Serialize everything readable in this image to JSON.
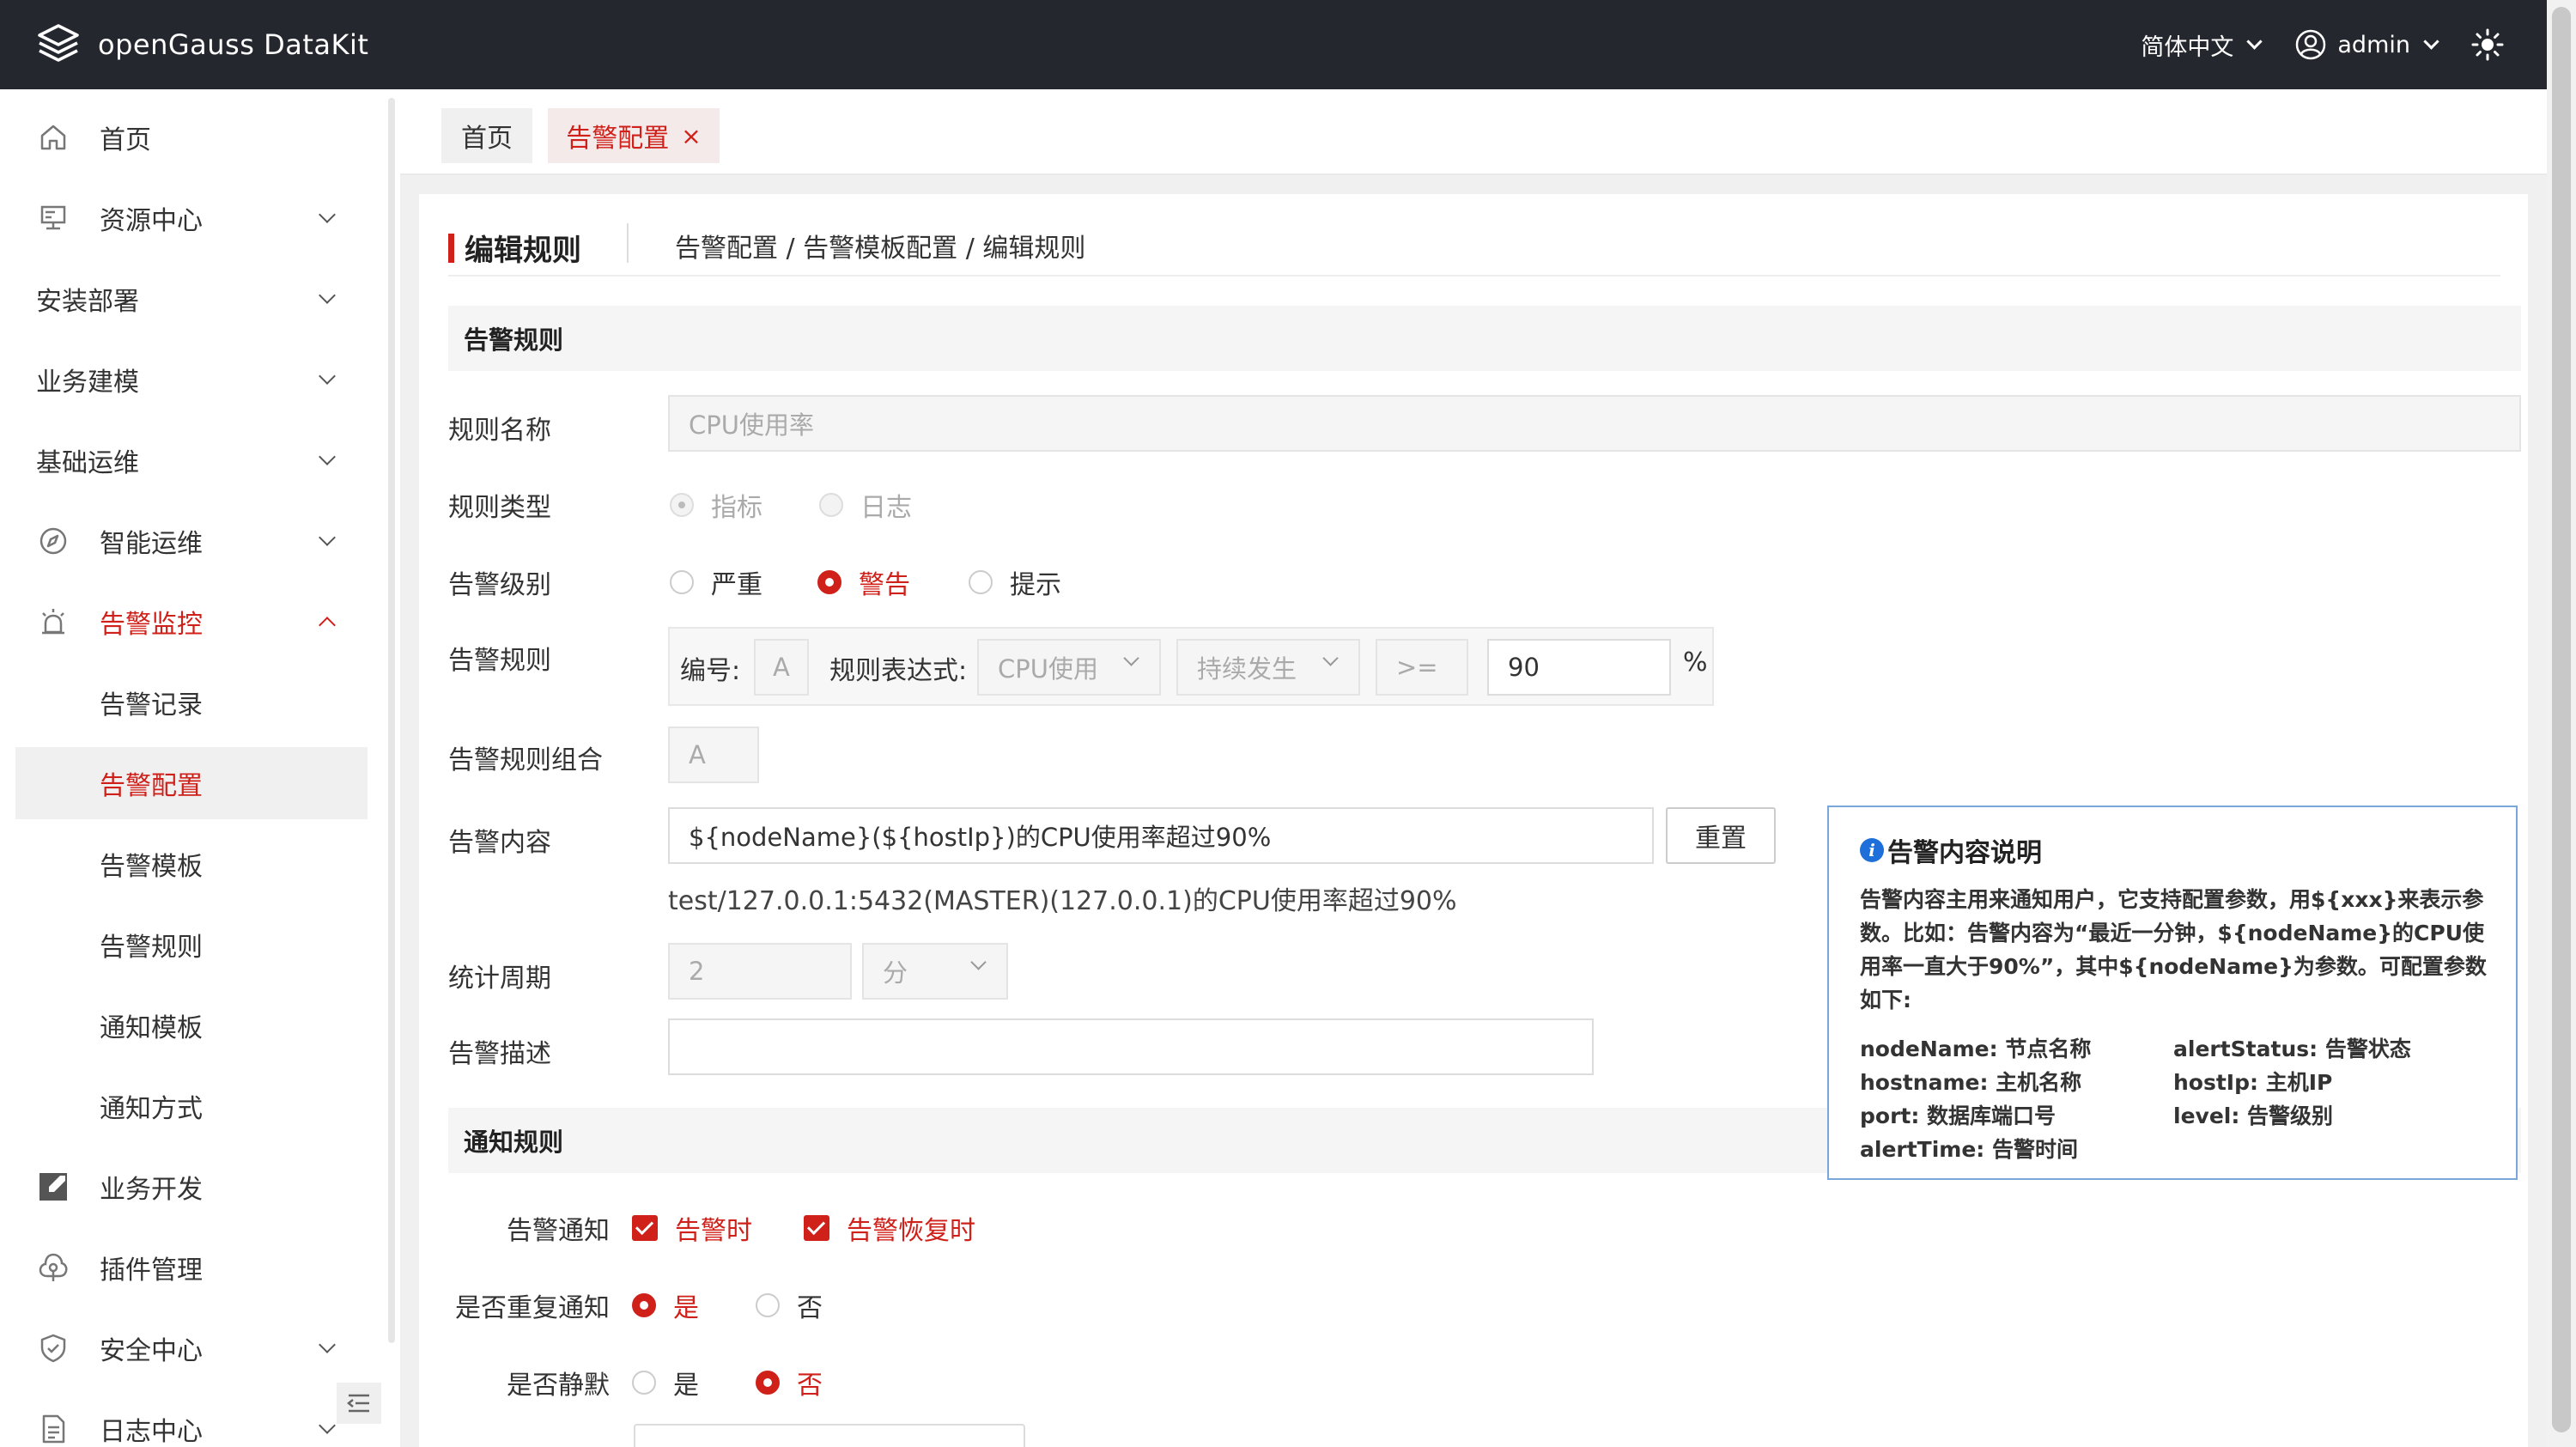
{
  "topbar": {
    "brand": "openGauss DataKit",
    "language": "简体中文",
    "user": "admin",
    "icons": [
      "layers-logo-icon",
      "user-circle-icon",
      "sun-icon"
    ]
  },
  "sidebar": {
    "items": [
      {
        "label": "首页",
        "icon": "home-icon"
      },
      {
        "label": "资源中心",
        "icon": "server-icon"
      },
      {
        "label": "安装部署"
      },
      {
        "label": "业务建模"
      },
      {
        "label": "基础运维"
      },
      {
        "label": "智能运维",
        "icon": "compass-icon"
      },
      {
        "label": "告警监控",
        "icon": "alarm-icon"
      },
      {
        "label": "告警记录"
      },
      {
        "label": "告警配置"
      },
      {
        "label": "告警模板"
      },
      {
        "label": "告警规则"
      },
      {
        "label": "通知模板"
      },
      {
        "label": "通知方式"
      },
      {
        "label": "业务开发",
        "icon": "edit-box-icon"
      },
      {
        "label": "插件管理",
        "icon": "plugin-icon"
      },
      {
        "label": "安全中心",
        "icon": "shield-icon"
      },
      {
        "label": "日志中心",
        "icon": "document-icon"
      }
    ]
  },
  "tabs": [
    {
      "label": "首页"
    },
    {
      "label": "告警配置",
      "close": "×"
    }
  ],
  "page": {
    "title": "编辑规则",
    "breadcrumb": "告警配置 / 告警模板配置 / 编辑规则"
  },
  "form": {
    "section_alert": "告警规则",
    "rule_name_label": "规则名称",
    "rule_name_placeholder": "CPU使用率",
    "rule_type_label": "规则类型",
    "rule_type_options": [
      "指标",
      "日志"
    ],
    "level_label": "告警级别",
    "level_options": [
      "严重",
      "警告",
      "提示"
    ],
    "rule_label": "告警规则",
    "rule_no_label": "编号:",
    "rule_no_value": "A",
    "rule_expr_label": "规则表达式:",
    "rule_metric": "CPU使用",
    "rule_duration": "持续发生",
    "rule_operator": ">=",
    "rule_threshold": "90",
    "rule_unit": "%",
    "combo_label": "告警规则组合",
    "combo_value": "A",
    "content_label": "告警内容",
    "content_value": "${nodeName}(${hostIp})的CPU使用率超过90%",
    "reset_button": "重置",
    "content_preview": "test/127.0.0.1:5432(MASTER)(127.0.0.1)的CPU使用率超过90%",
    "period_label": "统计周期",
    "period_value": "2",
    "period_unit": "分",
    "desc_label": "告警描述",
    "desc_value": ""
  },
  "notify": {
    "section": "通知规则",
    "notify_label": "告警通知",
    "notify_on_alert": "告警时",
    "notify_on_recover": "告警恢复时",
    "repeat_label": "是否重复通知",
    "repeat_yes": "是",
    "repeat_no": "否",
    "silent_label": "是否静默",
    "silent_yes": "是",
    "silent_no": "否"
  },
  "help": {
    "title": "告警内容说明",
    "description": "告警内容主用来通知用户，它支持配置参数，用${xxx}来表示参数。比如：告警内容为“最近一分钟，${nodeName}的CPU使用率一直大于90%”，其中${nodeName}为参数。可配置参数如下:",
    "params": [
      "nodeName: 节点名称",
      "alertStatus: 告警状态",
      "hostname: 主机名称",
      "hostIp: 主机IP",
      "port: 数据库端口号",
      "level: 告警级别",
      "alertTime: 告警时间"
    ]
  },
  "colors": {
    "accent": "#d0201a",
    "topbar": "#24272e",
    "info": "#1e6fd9"
  }
}
